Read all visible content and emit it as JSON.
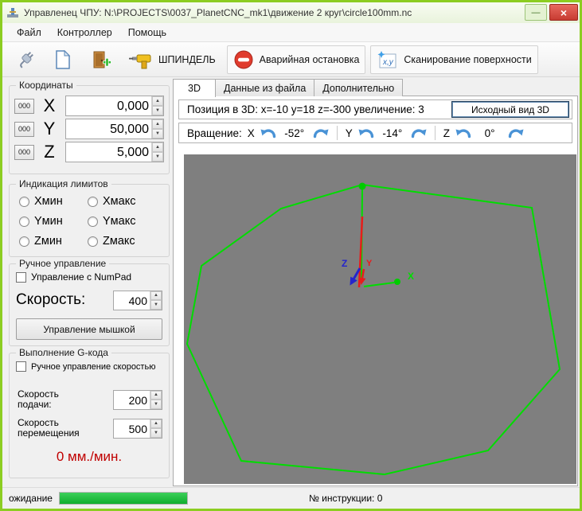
{
  "window": {
    "title": "Управленец ЧПУ: N:\\PROJECTS\\0037_PlanetCNC_mk1\\движение 2 круг\\circle100mm.nc",
    "close_glyph": "×",
    "minimize_glyph": "—"
  },
  "menu": {
    "file": "Файл",
    "controller": "Контроллер",
    "help": "Помощь"
  },
  "toolbar": {
    "spindle": "ШПИНДЕЛЬ",
    "estop": "Аварийная остановка",
    "scan": "Сканирование поверхности",
    "scan_icon_text": "x,y"
  },
  "coords": {
    "title": "Координаты",
    "zero": "000",
    "axes": [
      {
        "label": "X",
        "value": "0,000"
      },
      {
        "label": "Y",
        "value": "50,000"
      },
      {
        "label": "Z",
        "value": "5,000"
      }
    ]
  },
  "limits": {
    "title": "Индикация лимитов",
    "items": [
      "Хмин",
      "Хмакс",
      "Yмин",
      "Yмакс",
      "Zмин",
      "Zмакс"
    ]
  },
  "manual": {
    "title": "Ручное управление",
    "numpad": "Управление с NumPad",
    "speed_label": "Скорость:",
    "speed_value": "400",
    "mouse_button": "Управление мышкой"
  },
  "gcode": {
    "title": "Выполнение G-кода",
    "manual_speed": "Ручное управление скоростью",
    "feed_label": "Скорость подачи:",
    "feed_value": "200",
    "move_label": "Скорость перемещения",
    "move_value": "500",
    "rate": "0 мм./мин."
  },
  "tabs": [
    {
      "label": "3D"
    },
    {
      "label": "Данные из файла"
    },
    {
      "label": "Дополнительно"
    }
  ],
  "view3d": {
    "position": "Позиция в 3D: x=-10 y=18 z=-300 увеличение: 3",
    "reset_button": "Исходный вид 3D",
    "rotation_label": "Вращение:",
    "rotation": [
      {
        "axis": "X",
        "angle": "-52°"
      },
      {
        "axis": "Y",
        "angle": "-14°"
      },
      {
        "axis": "Z",
        "angle": "0°"
      }
    ],
    "axis_labels": {
      "x": "X",
      "y": "Y",
      "z": "Z"
    }
  },
  "statusbar": {
    "status": "ожидание",
    "instruction": "№ инструкции: 0"
  },
  "ui": {
    "spin_up": "▲",
    "spin_down": "▼"
  },
  "colors": {
    "frame": "#8ccd21",
    "close_button": "#d8453c",
    "viewport_bg": "#7f7f7f",
    "path_green": "#00dd00",
    "axis_red": "#e81c1c",
    "axis_blue": "#2525cc",
    "rate_red": "#c00000",
    "progress_green": "#0fae2d",
    "rotate_arrow_blue": "#4a93d6"
  }
}
